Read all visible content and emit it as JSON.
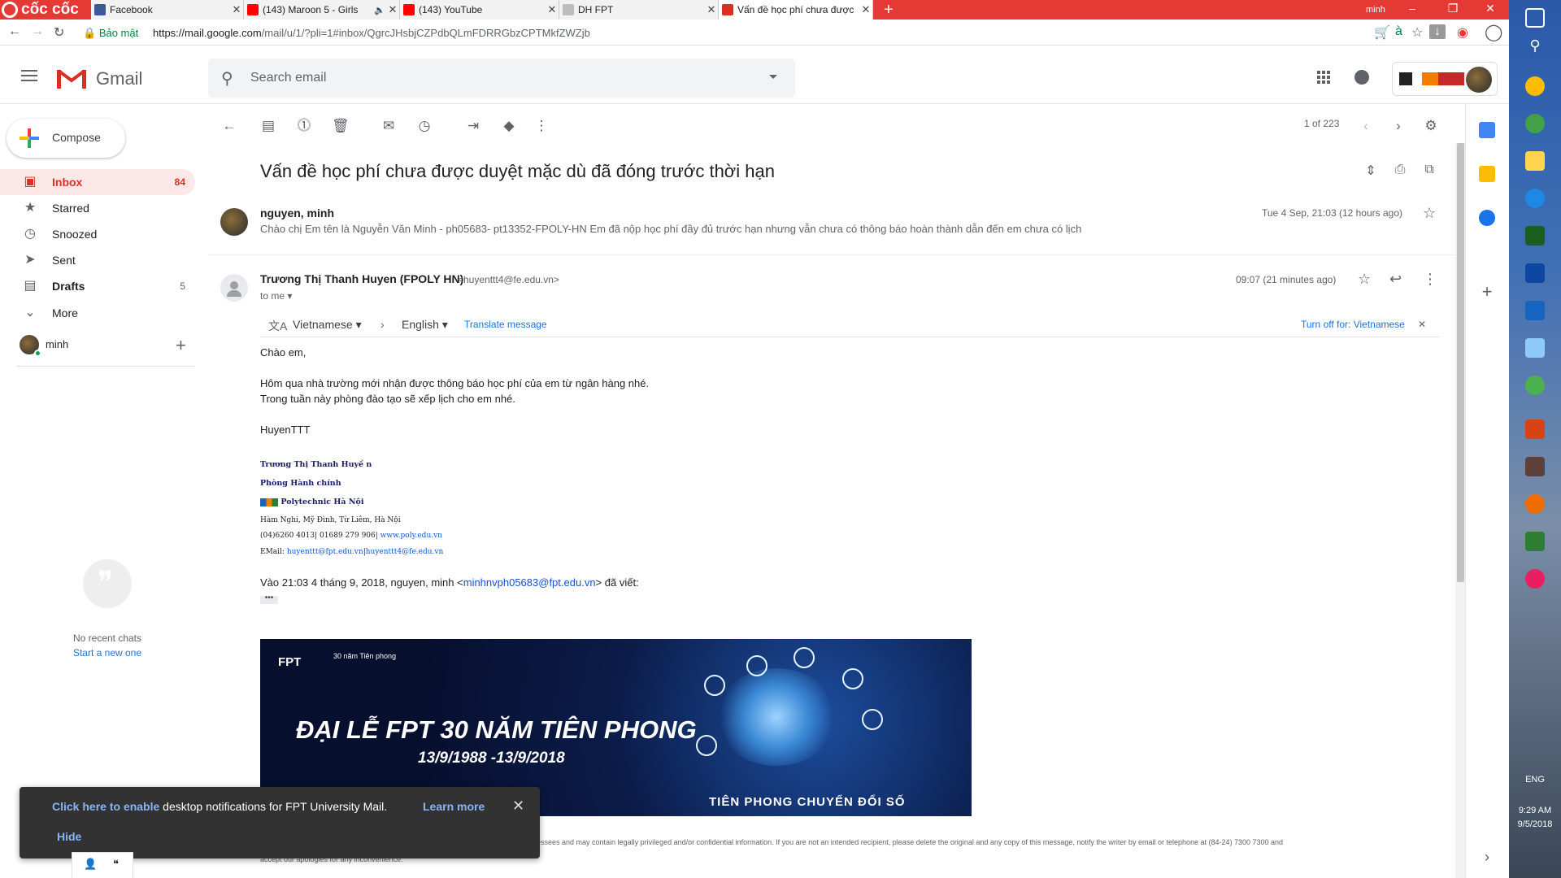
{
  "browser": {
    "logo_text": "cốc cốc",
    "tabs": [
      {
        "title": "Facebook",
        "favicon_color": "#3b5998"
      },
      {
        "title": "(143) Maroon 5 - Girls",
        "favicon_color": "#ff0000"
      },
      {
        "title": "(143) YouTube",
        "favicon_color": "#ff0000"
      },
      {
        "title": "DH FPT",
        "favicon_color": "#9e9e9e"
      },
      {
        "title": "Vấn đề học phí chưa được",
        "favicon_color": "#d93025"
      }
    ],
    "profile_name": "minh",
    "secure_label": "Bảo mật",
    "url_host": "https://mail.google.com",
    "url_rest": "/mail/u/1/?pli=1#inbox/QgrcJHsbjCZPdbQLmFDRRGbzCPTMkfZWZjb"
  },
  "gmail": {
    "product_name": "Gmail",
    "search_placeholder": "Search email",
    "compose_label": "Compose",
    "nav": [
      {
        "label": "Inbox",
        "count": "84",
        "icon": "inbox-icon"
      },
      {
        "label": "Starred",
        "count": "",
        "icon": "star-icon"
      },
      {
        "label": "Snoozed",
        "count": "",
        "icon": "clock-icon"
      },
      {
        "label": "Sent",
        "count": "",
        "icon": "send-icon"
      },
      {
        "label": "Drafts",
        "count": "5",
        "icon": "draft-icon"
      },
      {
        "label": "More",
        "count": "",
        "icon": "chevron-down-icon"
      }
    ],
    "hangouts_user": "minh",
    "no_chats": "No recent chats",
    "start_chat": "Start a new one",
    "pager": "1 of 223"
  },
  "thread": {
    "subject": "Vấn đề học phí chưa được duyệt mặc dù đã đóng trước thời hạn",
    "message1": {
      "from": "nguyen, minh",
      "snippet": "Chào chị Em tên là Nguyễn Văn Minh - ph05683- pt13352-FPOLY-HN Em đã nộp học phí đầy đủ trước hạn nhưng vẫn chưa có thông báo hoàn thành dẫn đến em chưa có lịch",
      "date": "Tue 4 Sep, 21:03 (12 hours ago)"
    },
    "message2": {
      "from_name": "Trương Thị Thanh Huyen (FPOLY HN)",
      "from_email": "<huyenttt4@fe.edu.vn>",
      "to": "to me",
      "time": "09:07 (21 minutes ago)",
      "translate": {
        "source_lang": "Vietnamese",
        "target_lang": "English",
        "action": "Translate message",
        "turn_off": "Turn off for: Vietnamese"
      },
      "body": [
        "Chào em,",
        "Hôm qua nhà trường mới nhận được thông báo học phí của em từ ngân hàng nhé.",
        "Trong tuần này phòng đào tạo sẽ xếp lịch cho em nhé.",
        "HuyenTTT"
      ],
      "signature": {
        "name": "Trương Thị Thanh Huyề n",
        "dept": "Phòng Hành chính",
        "org": "Polytechnic Hà Nội",
        "address": "Hàm Nghi, Mỹ Đình, Từ Liêm, Hà Nội",
        "phone": "(04)6260 4013| 01689 279 906|",
        "website": " www.poly.edu.vn",
        "email_label": "EMail:",
        "email1": "huyenttt@fpt.edu.vn",
        "email2": "huyenttt4@fe.edu.vn"
      },
      "quote_prefix": "Vào 21:03 4 tháng 9, 2018, nguyen, minh <",
      "quote_email": "minhnvph05683@fpt.edu.vn",
      "quote_suffix": "> đã viết:",
      "dots": "•••"
    },
    "banner": {
      "logo": "FPT",
      "anniversary": "30 năm Tiên phong",
      "title": "ĐẠI LỄ FPT 30 NĂM TIÊN PHONG",
      "dates": "13/9/1988 -13/9/2018",
      "slogan": "TIÊN PHONG CHUYỂN ĐỔI SỐ"
    },
    "disclaimer": "essees and may contain legally privileged and/or confidential information.  If you are not an intended recipient, please delete the original and any copy of this message, notify the writer by email or telephone at (84-24) 7300 7300 and",
    "disclaimer2": "accept our apologies for any inconvenience."
  },
  "toast": {
    "enable_link": "Click here to enable",
    "message": " desktop notifications for FPT University Mail.",
    "learn_more": "Learn more",
    "hide": "Hide"
  },
  "taskbar": {
    "lang": "ENG",
    "time": "9:29 AM",
    "date": "9/5/2018"
  },
  "colors": {
    "accent_red": "#d93025",
    "link_blue": "#1a73e8",
    "chrome_red": "#e53935"
  }
}
